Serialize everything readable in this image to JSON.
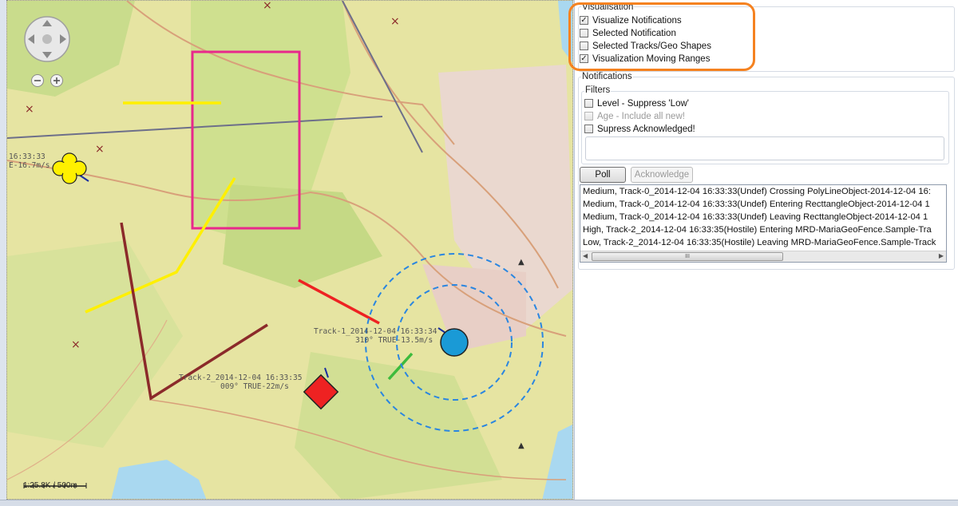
{
  "map": {
    "scale_label": "1:25.8K / 500m",
    "tracks": [
      {
        "name": "track-0",
        "lines": [
          "16:33:33",
          "E-16.7m/s"
        ]
      },
      {
        "name": "track-1",
        "lines": [
          "Track-1_2014-12-04 16:33:34",
          "310° TRUE-13.5m/s"
        ]
      },
      {
        "name": "track-2",
        "lines": [
          "Track-2_2014-12-04 16:33:35",
          "009° TRUE-22m/s"
        ]
      }
    ],
    "colors": {
      "rect": "#e8288c",
      "highlight": "#f58220",
      "track_blue": "#1a9ad6",
      "track_red": "#ee2222",
      "track_yellow": "#fff000"
    }
  },
  "panel": {
    "visualisation": {
      "legend": "Visualisation",
      "items": [
        {
          "label": "Visualize Notifications",
          "checked": "✓"
        },
        {
          "label": "Selected Notification",
          "checked": ""
        },
        {
          "label": "Selected Tracks/Geo Shapes",
          "checked": ""
        },
        {
          "label": "Visualization Moving Ranges",
          "checked": "✓"
        }
      ]
    },
    "notifications": {
      "legend": "Notifications",
      "filters_legend": "Filters",
      "filters": [
        {
          "label": "Level - Suppress 'Low'",
          "checked": ""
        },
        {
          "label": "Age - Include all new!",
          "checked": ""
        },
        {
          "label": "Supress Acknowledged!",
          "checked": ""
        }
      ],
      "poll_label": "Poll",
      "acknowledge_label": "Acknowledge",
      "log": [
        "Medium, Track-0_2014-12-04 16:33:33(Undef) Crossing PolyLineObject-2014-12-04 16:",
        "Medium, Track-0_2014-12-04 16:33:33(Undef) Entering RecttangleObject-2014-12-04 1",
        "Medium, Track-0_2014-12-04 16:33:33(Undef) Leaving RecttangleObject-2014-12-04 1",
        "High, Track-2_2014-12-04 16:33:35(Hostile) Entering MRD-MariaGeoFence.Sample-Tra",
        "Low, Track-2_2014-12-04 16:33:35(Hostile) Leaving MRD-MariaGeoFence.Sample-Track"
      ],
      "scroll_thumb": "III"
    }
  }
}
